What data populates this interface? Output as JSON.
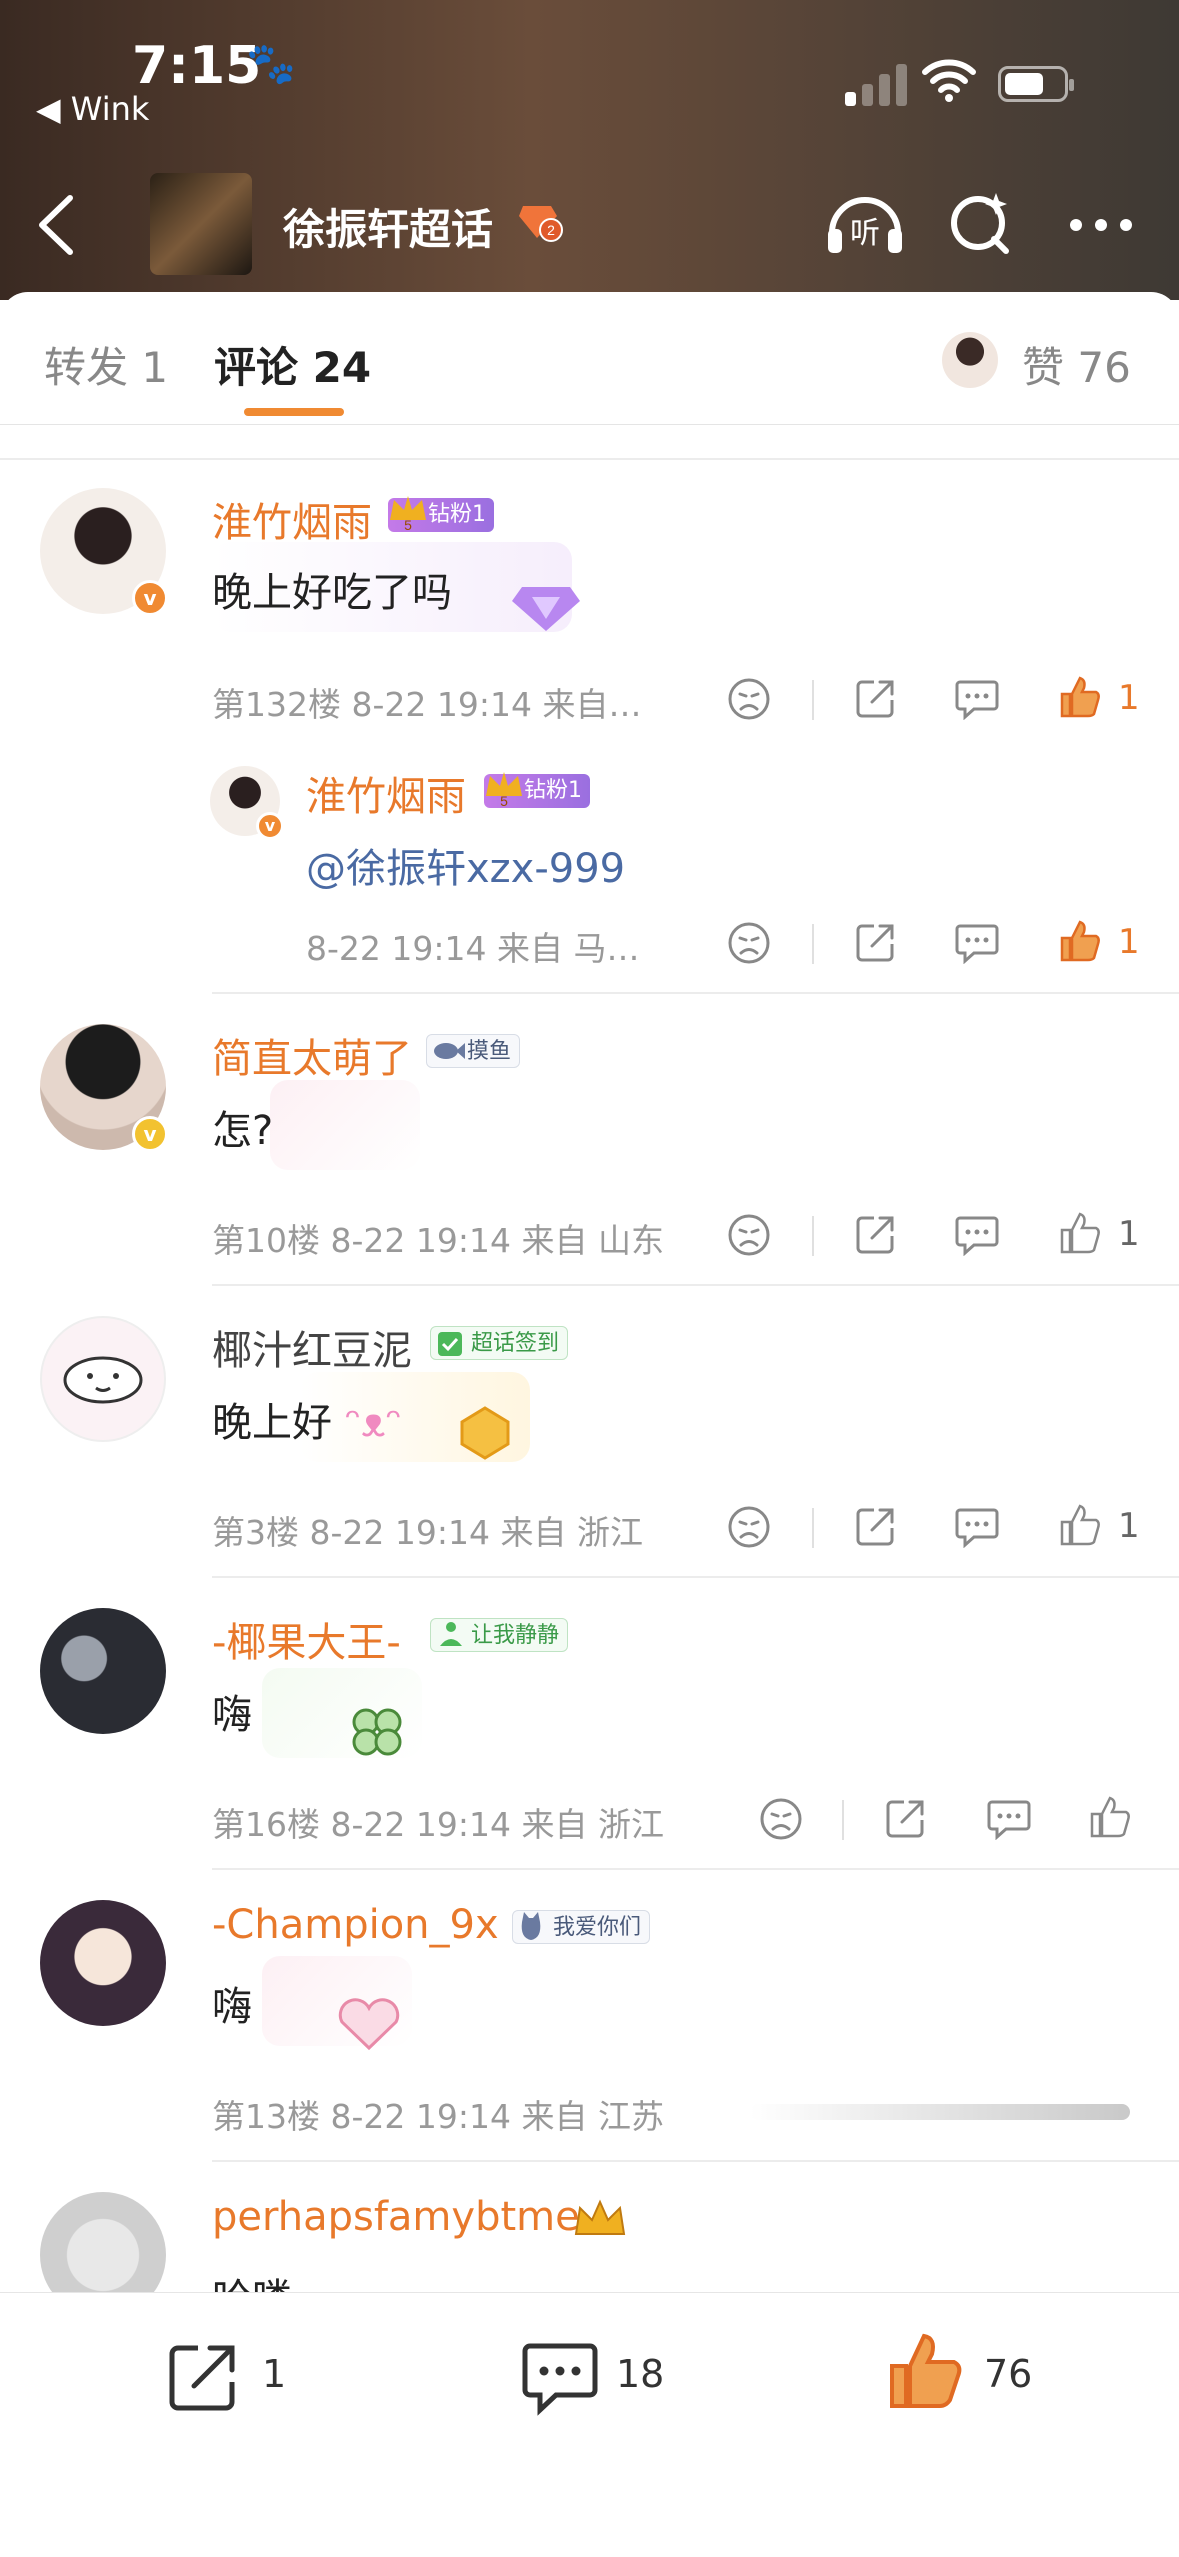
{
  "status_bar": {
    "time": "7:15",
    "back_app": "◀ Wink"
  },
  "header": {
    "topic_title": "徐振轩超话",
    "topic_level": "2"
  },
  "tabs": {
    "repost": "转发 1",
    "comments": "评论 24",
    "likes": "赞 76"
  },
  "comments": [
    {
      "user": "淮竹烟雨",
      "tag": "钻粉1",
      "tag_level": "5",
      "text": "晚上好吃了吗",
      "meta": "第132楼 8-22 19:14 来自…",
      "likes": "1",
      "liked": true
    },
    {
      "user": "淮竹烟雨",
      "tag": "钻粉1",
      "tag_level": "5",
      "text": "@徐振轩xzx-999",
      "meta": "8-22 19:14 来自 马…",
      "likes": "1",
      "liked": true
    },
    {
      "user": "简直太萌了",
      "tag": "摸鱼",
      "text": "怎?",
      "meta": "第10楼 8-22 19:14 来自 山东",
      "likes": "1",
      "liked": false
    },
    {
      "user": "椰汁红豆泥",
      "tag": "超话签到",
      "text": "晚上好",
      "meta": "第3楼 8-22 19:14 来自 浙江",
      "likes": "1",
      "liked": false
    },
    {
      "user": "-椰果大王-",
      "tag": "让我静静",
      "text": "嗨",
      "meta": "第16楼 8-22 19:14 来自 浙江",
      "likes": "",
      "liked": false
    },
    {
      "user": "-Champion_9x",
      "tag": "我爱你们",
      "text": "嗨",
      "meta": "第13楼 8-22 19:14 来自 江苏"
    },
    {
      "user": "perhapsfamybtme",
      "text": "哈喽"
    }
  ],
  "bottom_bar": {
    "repost_count": "1",
    "comment_count": "18",
    "like_count": "76"
  },
  "colors": {
    "accent": "#e8792b",
    "link": "#4a6aa3",
    "meta": "#999999"
  },
  "icons": [
    "back-icon",
    "listen-icon",
    "super-topic-search-icon",
    "more-icon",
    "dislike-icon",
    "share-icon",
    "comment-icon",
    "thumbs-up-icon"
  ]
}
